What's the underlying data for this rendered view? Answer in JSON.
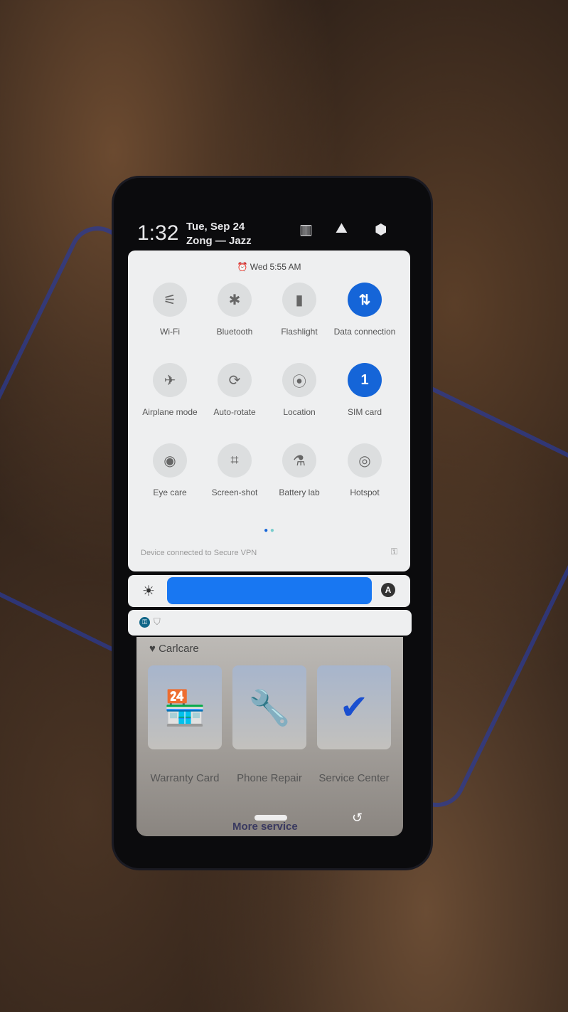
{
  "status": {
    "time": "1:32",
    "date": "Tue, Sep 24",
    "carrier": "Zong — Jazz"
  },
  "header_icons": [
    "edit-tiles-icon",
    "gallery-icon",
    "settings-icon"
  ],
  "alarm": "Wed 5:55 AM",
  "tiles": [
    {
      "label": "Wi-Fi",
      "icon": "wifi-off-icon",
      "glyph": "⚟",
      "on": false
    },
    {
      "label": "Bluetooth",
      "icon": "bluetooth-icon",
      "glyph": "✱",
      "on": false
    },
    {
      "label": "Flashlight",
      "icon": "flashlight-icon",
      "glyph": "▮",
      "on": false
    },
    {
      "label": "Data connection",
      "icon": "data-icon",
      "glyph": "⇅",
      "on": true
    },
    {
      "label": "Airplane mode",
      "icon": "airplane-icon",
      "glyph": "✈",
      "on": false
    },
    {
      "label": "Auto-rotate",
      "icon": "rotate-icon",
      "glyph": "⟳",
      "on": false
    },
    {
      "label": "Location",
      "icon": "location-icon",
      "glyph": "⦿",
      "on": false
    },
    {
      "label": "SIM card",
      "icon": "sim-icon",
      "glyph": "1",
      "on": true
    },
    {
      "label": "Eye care",
      "icon": "eye-icon",
      "glyph": "◉",
      "on": false
    },
    {
      "label": "Screen-shot",
      "icon": "crop-icon",
      "glyph": "⌗",
      "on": false
    },
    {
      "label": "Battery lab",
      "icon": "flask-icon",
      "glyph": "⚗",
      "on": false
    },
    {
      "label": "Hotspot",
      "icon": "hotspot-icon",
      "glyph": "◎",
      "on": false
    }
  ],
  "vpn_text": "Device connected to Secure VPN",
  "brightness": {
    "level": 1.0,
    "auto_label": "A"
  },
  "app": {
    "title": "Carlcare",
    "cards": [
      {
        "label": "Warranty Card",
        "glyph": "🏪"
      },
      {
        "label": "Phone Repair",
        "glyph": "🔧"
      },
      {
        "label": "Service Center",
        "glyph": "✔"
      }
    ],
    "more": "More service"
  }
}
